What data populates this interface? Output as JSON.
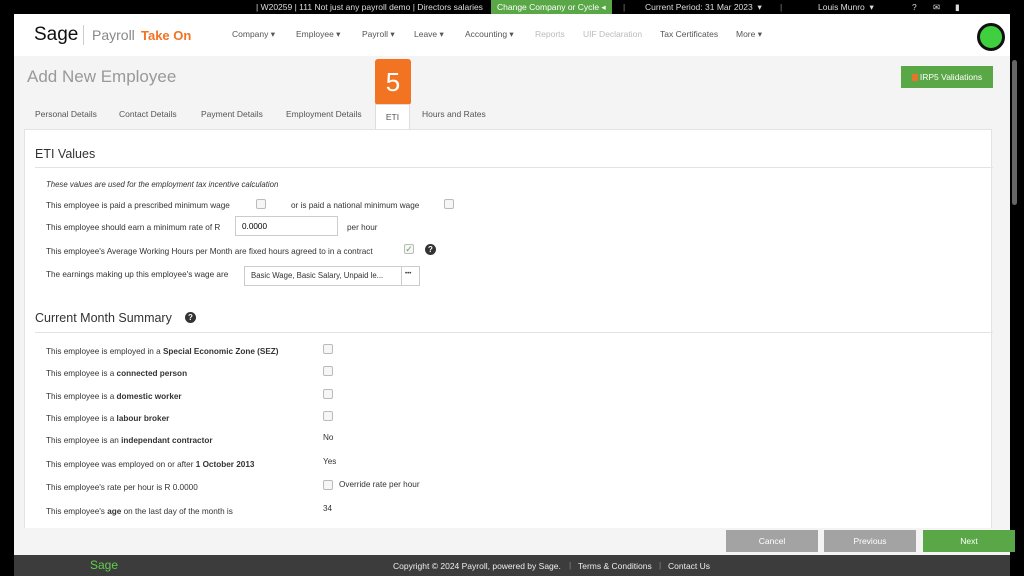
{
  "topbar": {
    "company": "| W20259 | 111 Not just any payroll demo | Directors salaries",
    "change_label": "Change Company or Cycle",
    "period": "Current Period: 31 Mar 2023",
    "user": "Louis Munro",
    "help": "?"
  },
  "header": {
    "brand": "Sage",
    "product": "Payroll",
    "edition": "Take On",
    "nav": [
      {
        "label": "Company ▾"
      },
      {
        "label": "Employee ▾"
      },
      {
        "label": "Payroll ▾"
      },
      {
        "label": "Leave ▾"
      },
      {
        "label": "Accounting ▾"
      },
      {
        "label": "Reports"
      },
      {
        "label": "UIF Declaration"
      },
      {
        "label": "Tax Certificates"
      },
      {
        "label": "More ▾"
      }
    ]
  },
  "page": {
    "title": "Add New Employee",
    "step": "5",
    "irp5_label": "IRP5 Validations",
    "tabs": [
      {
        "label": "Personal Details"
      },
      {
        "label": "Contact Details"
      },
      {
        "label": "Payment Details"
      },
      {
        "label": "Employment Details"
      },
      {
        "label": "ETI"
      },
      {
        "label": "Hours and Rates"
      }
    ]
  },
  "eti": {
    "heading": "ETI Values",
    "note": "These values are used for the employment tax incentive calculation",
    "prescribed_label": "This employee is paid a prescribed minimum wage",
    "prescribed_checked": false,
    "national_label": "or is paid a national minimum wage",
    "national_checked": false,
    "min_rate_label": "This employee should earn a minimum rate of R",
    "min_rate_value": "0.0000",
    "per_hour": "per hour",
    "fixed_hours_label": "This employee's Average Working Hours per Month are fixed hours agreed to in a contract",
    "fixed_hours_checked": true,
    "earnings_label": "The earnings making up this employee's wage are",
    "earnings_value": "Basic Wage, Basic Salary, Unpaid le...",
    "earnings_button": "•••"
  },
  "summary": {
    "heading": "Current Month Summary",
    "rows": [
      {
        "pre": "This employee is employed in a ",
        "bold": "Special Economic Zone (SEZ)",
        "post": "",
        "type": "checkbox",
        "checked": false
      },
      {
        "pre": "This employee is a ",
        "bold": "connected person",
        "post": "",
        "type": "checkbox",
        "checked": false
      },
      {
        "pre": "This employee is a ",
        "bold": "domestic worker",
        "post": "",
        "type": "checkbox",
        "checked": false
      },
      {
        "pre": "This employee is a ",
        "bold": "labour broker",
        "post": "",
        "type": "checkbox",
        "checked": false
      },
      {
        "pre": "This employee is an ",
        "bold": "independant contractor",
        "post": "",
        "type": "text",
        "value": "No"
      },
      {
        "pre": "This employee was employed on or after ",
        "bold": "1 October 2013",
        "post": "",
        "type": "text",
        "value": "Yes"
      },
      {
        "pre": "This employee's rate per hour is R 0.0000",
        "bold": "",
        "post": "",
        "type": "checkbox",
        "checked": false,
        "value": "Override rate per hour"
      },
      {
        "pre": "This employee's ",
        "bold": "age",
        "post": " on the last day of the month is",
        "type": "text",
        "value": "34"
      }
    ]
  },
  "buttons": {
    "cancel": "Cancel",
    "previous": "Previous",
    "next": "Next"
  },
  "footer": {
    "brand": "Sage",
    "copyright": "Copyright © 2024 Payroll, powered by Sage.",
    "terms": "Terms & Conditions",
    "contact": "Contact Us"
  },
  "colors": {
    "green": "#5aa747",
    "orange": "#f27321",
    "footer": "#3c3c3c"
  }
}
